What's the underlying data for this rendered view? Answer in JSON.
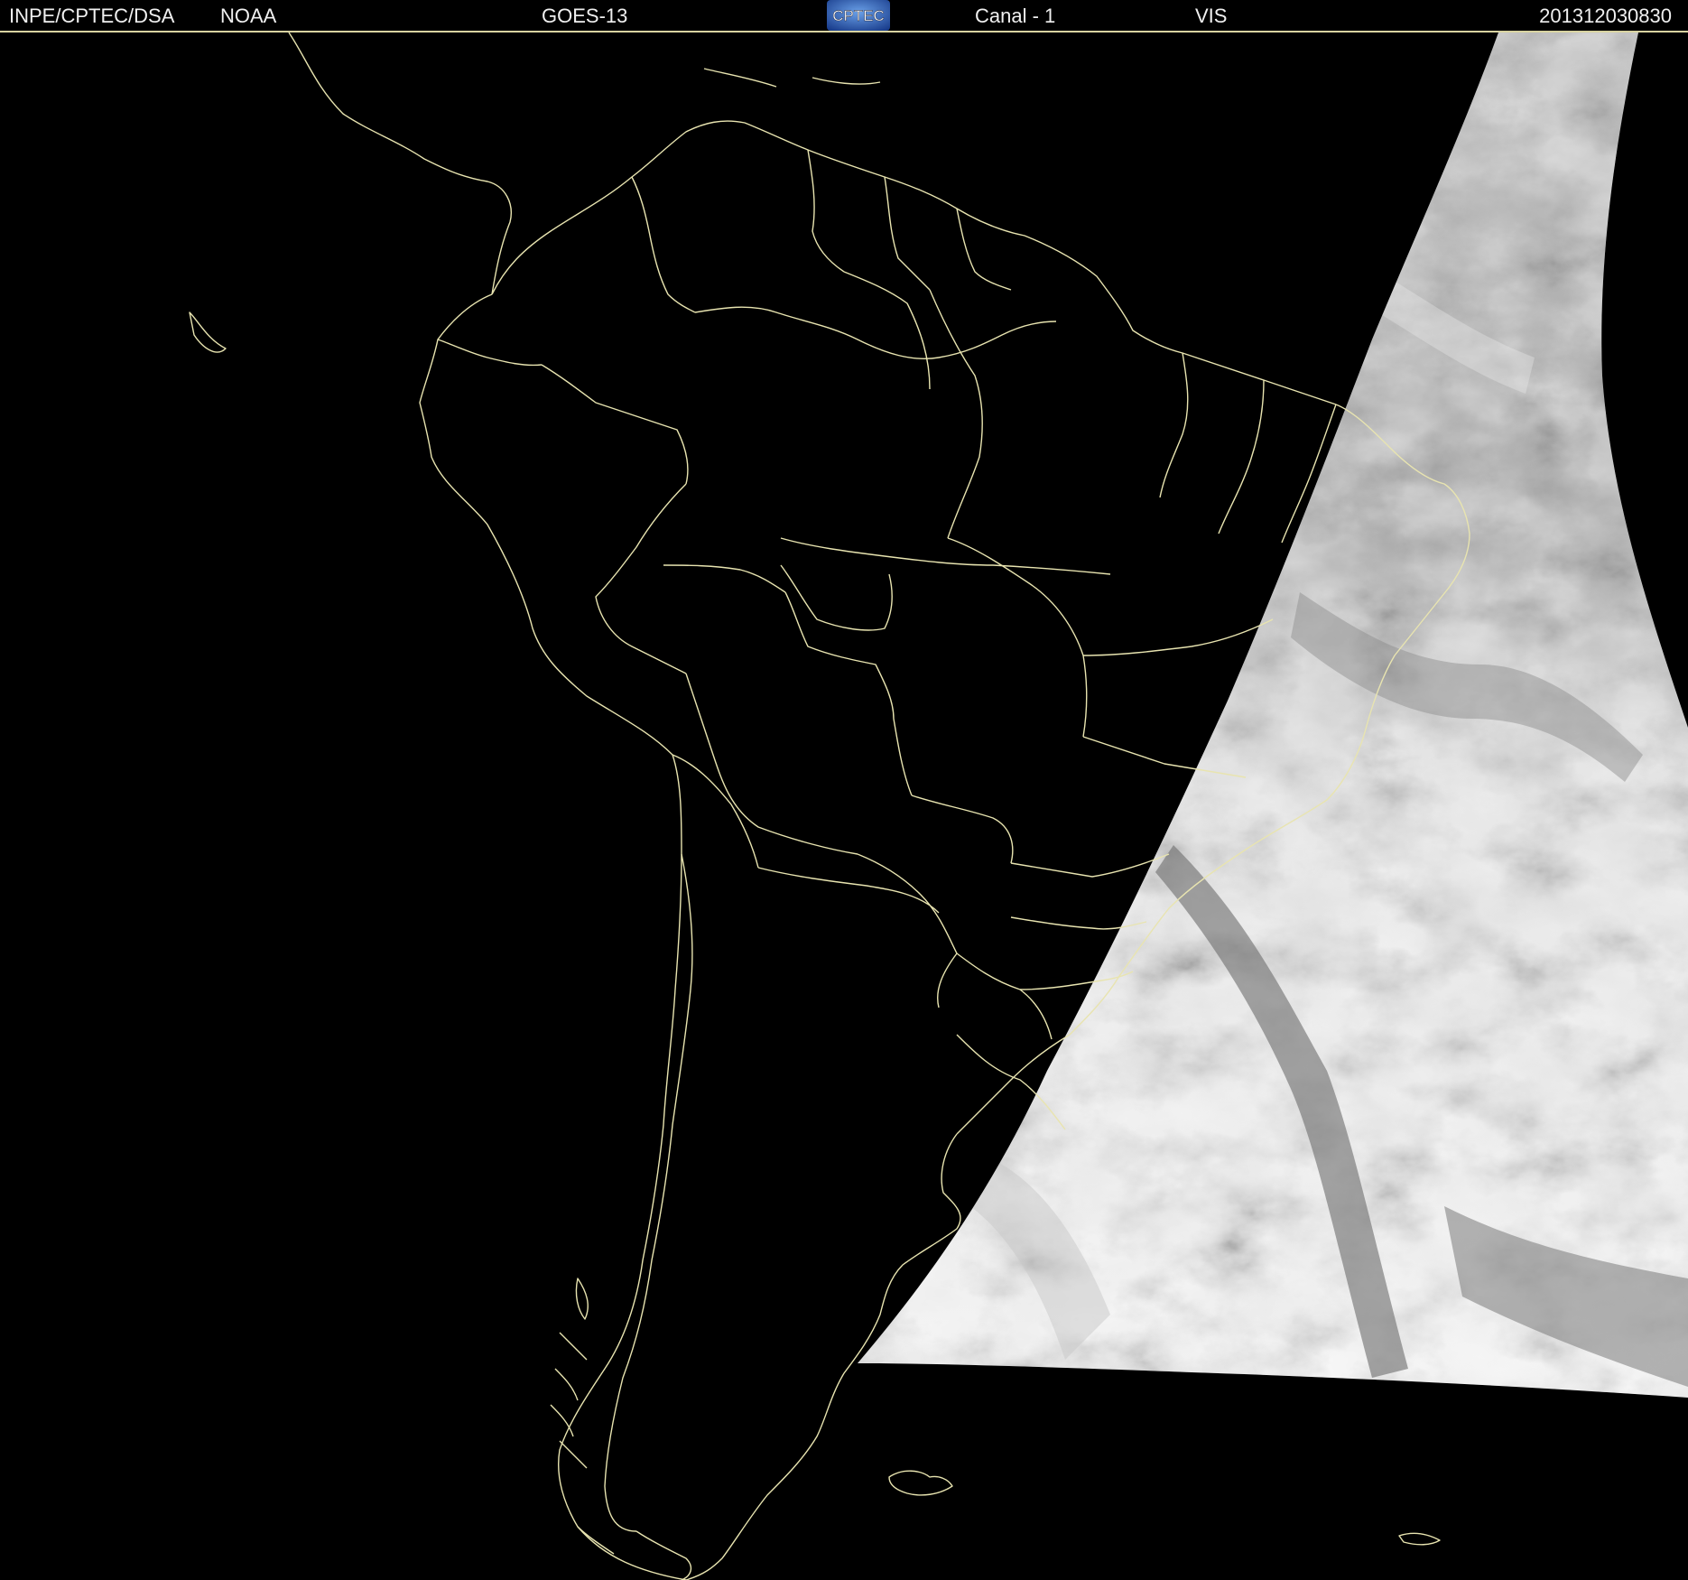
{
  "header": {
    "institution": "INPE/CPTEC/DSA",
    "agency": "NOAA",
    "satellite": "GOES-13",
    "logo_text": "CPTEC",
    "channel": "Canal - 1",
    "band": "VIS",
    "timestamp": "201312030830"
  },
  "colors": {
    "background": "#000000",
    "border_lines": "#e8e4b0",
    "header_text": "#f0f0f0",
    "cloud_bright": "#ececec",
    "cloud_mid": "#9a9a9a",
    "cloud_dark": "#5a5a5a",
    "logo_bg": "#2a4fa8"
  },
  "icons": {
    "logo": "cptec-logo-icon"
  }
}
